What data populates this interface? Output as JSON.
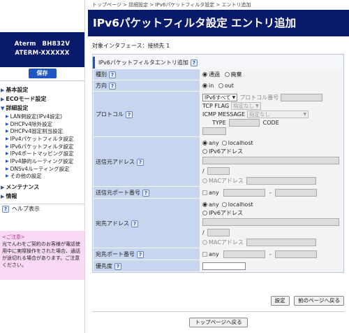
{
  "device": {
    "model": "Aterm　BH832V",
    "name": "ATERM-XXXXXX"
  },
  "sidebar": {
    "save_label": "保存",
    "groups": [
      {
        "label": "基本設定"
      },
      {
        "label": "ECOモード設定"
      },
      {
        "label": "詳細設定"
      }
    ],
    "items": [
      {
        "label": "LAN側設定(IPv4設定)"
      },
      {
        "label": "DHCPv4除外設定"
      },
      {
        "label": "DHCPv4固定割当設定"
      },
      {
        "label": "IPv4パケットフィルタ設定"
      },
      {
        "label": "IPv6パケットフィルタ設定"
      },
      {
        "label": "IPv4ポートマッピング設定"
      },
      {
        "label": "IPv4静的ルーティング設定"
      },
      {
        "label": "DNSv4ルーティング設定"
      },
      {
        "label": "その他の設定"
      }
    ],
    "groups2": [
      {
        "label": "メンテナンス"
      },
      {
        "label": "情報"
      }
    ],
    "help_label": "ヘルプ表示",
    "notice": {
      "title": "<ご注意>",
      "body": "光でんわをご契約のお客様が電話使用中に実際操作をされた場合、通話が途切れる場合があります。ご注意ください。"
    }
  },
  "breadcrumb": "トップページ > 詳細設定 > IPv6パケットフィルタ設定 > エントリ追加",
  "page_title": "IPv6パケットフィルタ設定 エントリ追加",
  "interface_line": "対象インタフェース：接続先 1",
  "panel_title": "IPv6パケットフィルタエントリ追加",
  "form": {
    "kind": {
      "label": "種別",
      "opt1": "通過",
      "opt2": "廃棄"
    },
    "direction": {
      "label": "方向",
      "opt1": "in",
      "opt2": "out"
    },
    "protocol": {
      "label": "プロトコル",
      "select_value": "IPv6すべて",
      "proto_num_label": "プロトコル番号",
      "tcp_flag_label": "TCP FLAG",
      "tcp_flag_value": "指定なし",
      "icmp_label": "ICMP MESSAGE",
      "icmp_value": "指定なし",
      "type_label": "TYPE",
      "code_label": "CODE"
    },
    "src_addr": {
      "label": "送信元アドレス",
      "any": "any",
      "localhost": "localhost",
      "ipv6": "IPv6アドレス",
      "slash": "/",
      "mac": "MACアドレス"
    },
    "src_port": {
      "label": "送信元ポート番号",
      "any": "any",
      "dash": "-"
    },
    "dst_addr": {
      "label": "宛先アドレス",
      "any": "any",
      "localhost": "localhost",
      "ipv6": "IPv6アドレス",
      "slash": "/",
      "mac": "MACアドレス"
    },
    "dst_port": {
      "label": "宛先ポート番号",
      "any": "any",
      "dash": "-"
    },
    "priority": {
      "label": "優先度"
    }
  },
  "buttons": {
    "set": "設定",
    "back": "前のページへ戻る",
    "top": "トップページへ戻る"
  }
}
